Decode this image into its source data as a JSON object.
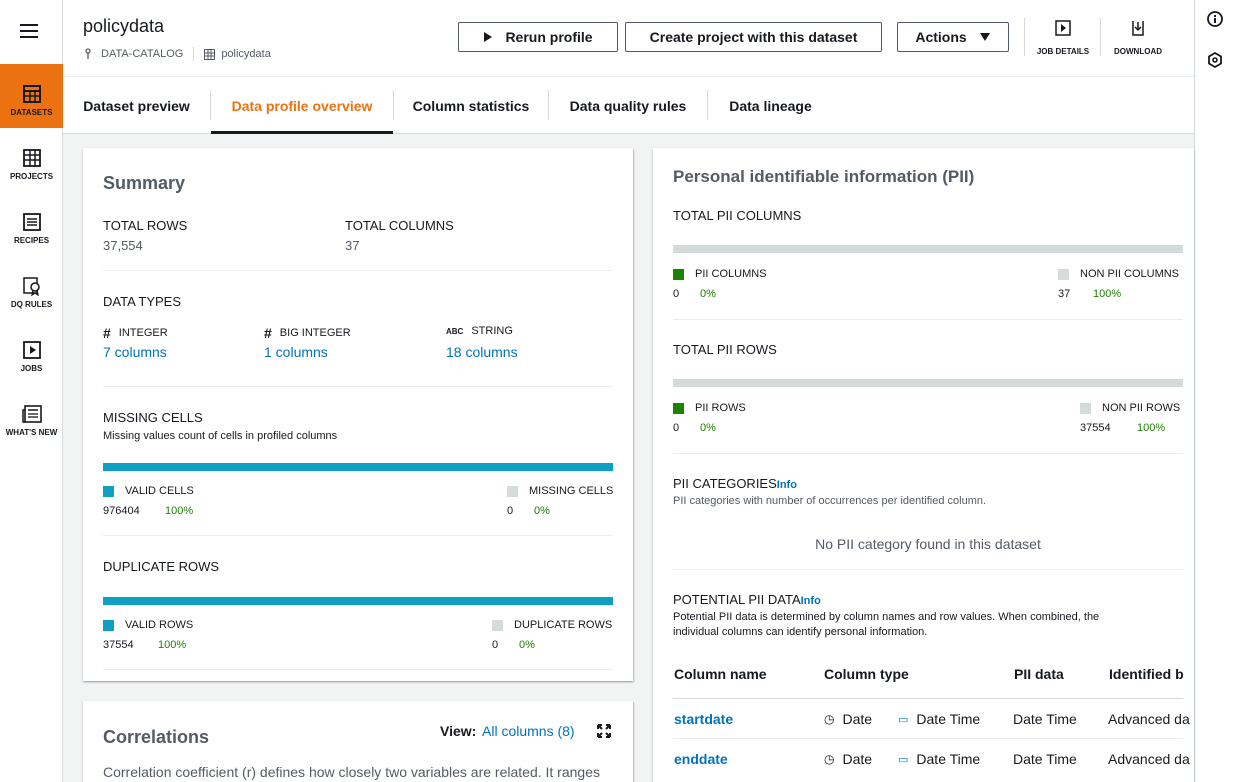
{
  "nav": {
    "items": [
      {
        "label": "DATASETS",
        "icon": "table-icon"
      },
      {
        "label": "PROJECTS",
        "icon": "grid-icon"
      },
      {
        "label": "RECIPES",
        "icon": "list-icon"
      },
      {
        "label": "DQ RULES",
        "icon": "ribbon-icon"
      },
      {
        "label": "JOBS",
        "icon": "play-icon"
      },
      {
        "label": "WHAT'S NEW",
        "icon": "newspaper-icon"
      }
    ],
    "active_color": "#ec7211"
  },
  "header": {
    "title": "policydata",
    "breadcrumb": {
      "catalog": "DATA-CATALOG",
      "dataset": "policydata"
    },
    "buttons": {
      "rerun": "Rerun profile",
      "create": "Create project with this dataset",
      "actions": "Actions"
    },
    "icons": {
      "job_details": "JOB DETAILS",
      "download": "DOWNLOAD"
    }
  },
  "tabs": [
    "Dataset preview",
    "Data profile overview",
    "Column statistics",
    "Data quality rules",
    "Data lineage"
  ],
  "active_tab": "Data profile overview",
  "summary": {
    "title": "Summary",
    "total_rows_label": "TOTAL ROWS",
    "total_rows": "37,554",
    "total_columns_label": "TOTAL COLUMNS",
    "total_columns": "37",
    "data_types_label": "DATA TYPES",
    "types": [
      {
        "icon": "#",
        "name": "INTEGER",
        "count": "7 columns"
      },
      {
        "icon": "#",
        "name": "BIG INTEGER",
        "count": "1 columns"
      },
      {
        "icon": "ABC",
        "name": "STRING",
        "count": "18 columns"
      }
    ],
    "missing_label": "MISSING CELLS",
    "missing_desc": "Missing values count of cells in profiled columns",
    "valid_cells_label": "VALID CELLS",
    "valid_cells": "976404",
    "valid_cells_pct": "100%",
    "missing_cells_label": "MISSING CELLS",
    "missing_cells": "0",
    "missing_cells_pct": "0%",
    "duplicate_label": "DUPLICATE ROWS",
    "valid_rows_label": "VALID ROWS",
    "valid_rows": "37554",
    "valid_rows_pct": "100%",
    "duplicate_rows_label": "DUPLICATE ROWS",
    "duplicate_rows": "0",
    "duplicate_rows_pct": "0%",
    "bar_color": "#0e9fc2",
    "missing_share": 0.0,
    "duplicate_share": 0.0
  },
  "correlations": {
    "title": "Correlations",
    "view_label": "View:",
    "view_value": "All columns (8)",
    "desc": "Correlation coefficient (r) defines how closely two variables are related. It ranges"
  },
  "pii": {
    "title": "Personal identifiable information (PII)",
    "total_cols_label": "TOTAL PII COLUMNS",
    "pii_cols_label": "PII COLUMNS",
    "pii_cols": "0",
    "pii_cols_pct": "0%",
    "non_pii_cols_label": "NON PII COLUMNS",
    "non_pii_cols": "37",
    "non_pii_cols_pct": "100%",
    "total_rows_label": "TOTAL PII ROWS",
    "pii_rows_label": "PII ROWS",
    "pii_rows": "0",
    "pii_rows_pct": "0%",
    "non_pii_rows_label": "NON PII ROWS",
    "non_pii_rows": "37554",
    "non_pii_rows_pct": "100%",
    "categories_label": "PII CATEGORIES",
    "info": "Info",
    "categories_desc": "PII categories with number of occurrences per identified column.",
    "no_category": "No PII category found in this dataset",
    "potential_label": "POTENTIAL PII DATA",
    "potential_desc_1": "Potential PII data is determined by column names and row values. When combined, the",
    "potential_desc_2": "individual columns can identify personal information.",
    "pii_color": "#1d8102",
    "pii_share": 0.0,
    "table": {
      "headers": [
        "Column name",
        "Column type",
        "PII data",
        "Identified b"
      ],
      "rows": [
        {
          "name": "startdate",
          "col_type": "Date",
          "type2": "Date Time",
          "pii": "Date Time",
          "identified": "Advanced da"
        },
        {
          "name": "enddate",
          "col_type": "Date",
          "type2": "Date Time",
          "pii": "Date Time",
          "identified": "Advanced da"
        }
      ]
    }
  }
}
